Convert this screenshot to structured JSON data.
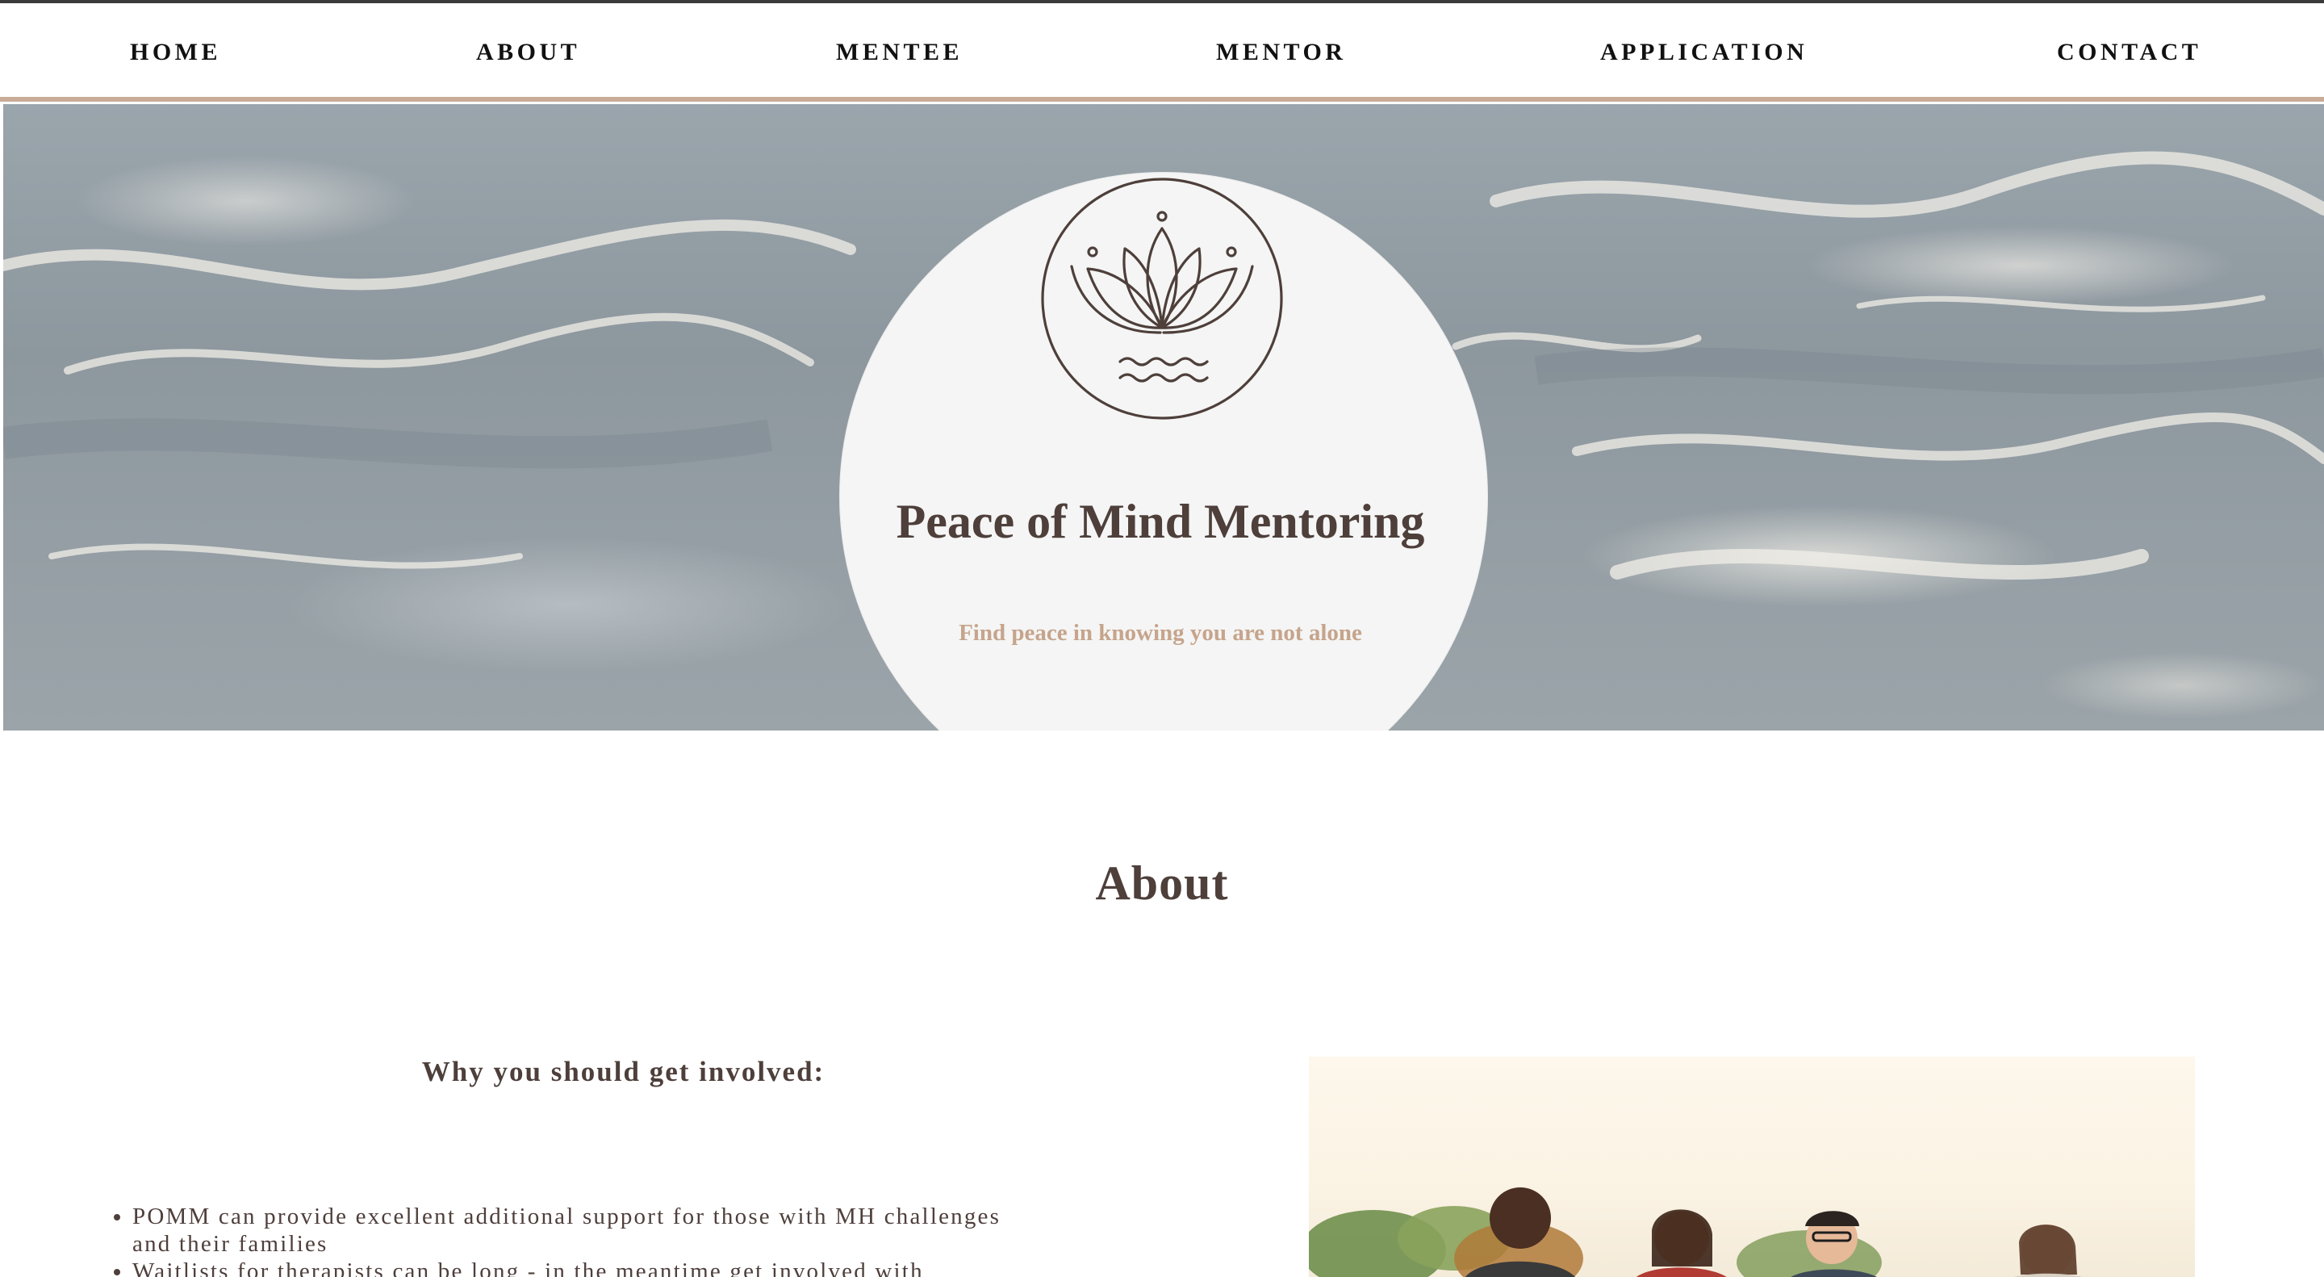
{
  "nav": {
    "items": [
      {
        "label": "HOME"
      },
      {
        "label": "ABOUT"
      },
      {
        "label": "MENTEE"
      },
      {
        "label": "MENTOR"
      },
      {
        "label": "APPLICATION"
      },
      {
        "label": "CONTACT"
      }
    ]
  },
  "hero": {
    "title": "Peace of Mind Mentoring",
    "tagline": "Find peace in knowing you are not alone",
    "logo_icon": "lotus-icon"
  },
  "about": {
    "heading": "About",
    "subheading": "Why you should get involved:",
    "bullets": [
      "POMM can provide excellent additional support for those with MH challenges and their families",
      "Waitlists for therapists can be long - in the meantime get involved with"
    ],
    "photo_icon": "group-photo"
  },
  "colors": {
    "text_brown": "#4e3f3b",
    "accent_tan": "#c6a48c",
    "nav_border": "#c9ab96",
    "circle_bg": "#f4f5f4"
  }
}
